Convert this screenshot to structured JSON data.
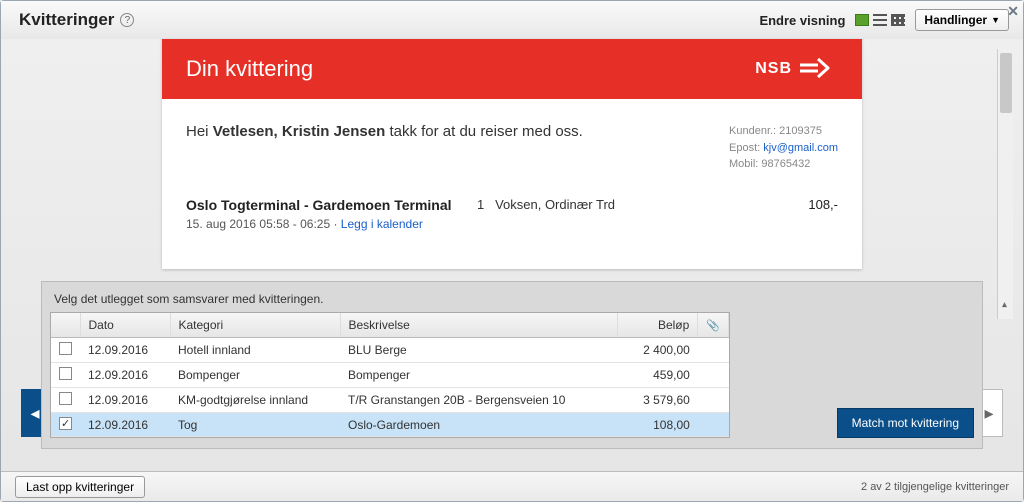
{
  "header": {
    "title": "Kvitteringer",
    "help_tooltip": "?",
    "view_label": "Endre visning",
    "actions_label": "Handlinger"
  },
  "receipt": {
    "hero_title": "Din kvittering",
    "brand": "NSB",
    "greeting_prefix": "Hei",
    "greeting_name": "Vetlesen, Kristin Jensen",
    "greeting_suffix": "takk for at du reiser med oss.",
    "customer": {
      "kundenr_label": "Kundenr.:",
      "kundenr": "2109375",
      "epost_label": "Epost:",
      "epost": "kjv@gmail.com",
      "mobil_label": "Mobil:",
      "mobil": "98765432"
    },
    "ticket": {
      "route": "Oslo Togterminal - Gardemoen Terminal",
      "datetime": "15. aug 2016 05:58 - 06:25",
      "calendar_link": "Legg i kalender",
      "qty": "1",
      "type": "Voksen, Ordinær Trd",
      "price": "108,-"
    }
  },
  "match": {
    "instruction": "Velg det utlegget som samsvarer med kvitteringen.",
    "columns": {
      "date": "Dato",
      "category": "Kategori",
      "description": "Beskrivelse",
      "amount": "Beløp"
    },
    "rows": [
      {
        "checked": false,
        "date": "12.09.2016",
        "category": "Hotell innland",
        "description": "BLU Berge",
        "amount": "2 400,00"
      },
      {
        "checked": false,
        "date": "12.09.2016",
        "category": "Bompenger",
        "description": "Bompenger",
        "amount": "459,00"
      },
      {
        "checked": false,
        "date": "12.09.2016",
        "category": "KM-godtgjørelse innland",
        "description": "T/R Granstangen 20B - Bergensveien 10",
        "amount": "3 579,60"
      },
      {
        "checked": true,
        "date": "12.09.2016",
        "category": "Tog",
        "description": "Oslo-Gardemoen",
        "amount": "108,00"
      }
    ],
    "match_button": "Match mot kvittering"
  },
  "footer": {
    "upload_button": "Last opp kvitteringer",
    "status": "2 av 2 tilgjengelige kvitteringer"
  }
}
